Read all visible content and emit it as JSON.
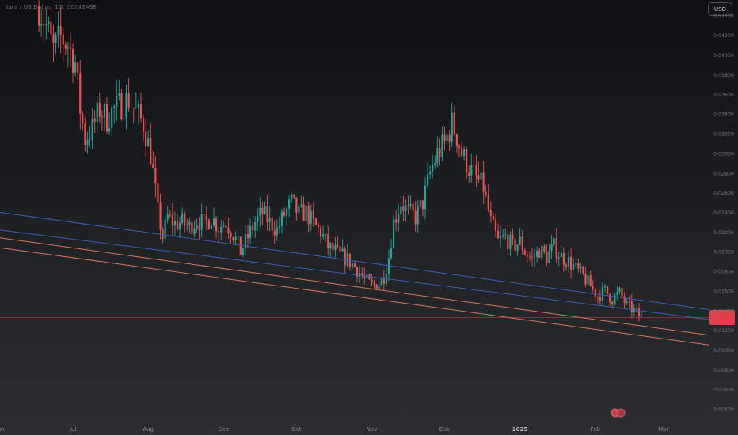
{
  "header": {
    "symbol_label": "Vara / US Dollar, 1D, COINBASE",
    "currency_button": "USD"
  },
  "colors": {
    "up": "#26a69a",
    "down": "#ef5350",
    "channel_blue": "#3d5fb8",
    "channel_orange": "#d8795e",
    "last_price": "#e0404b"
  },
  "chart_data": {
    "type": "candlestick",
    "x_axis": {
      "tick_labels": [
        "Jun",
        "Jul",
        "Aug",
        "Sep",
        "Oct",
        "Nov",
        "Dec",
        "2025",
        "Feb",
        "Mar"
      ],
      "tick_dates": [
        "2024-06-01",
        "2024-07-01",
        "2024-08-01",
        "2024-09-01",
        "2024-10-01",
        "2024-11-01",
        "2024-12-01",
        "2025-01-01",
        "2025-02-01",
        "2025-03-01"
      ],
      "range": [
        "2024-06-01",
        "2025-03-20"
      ]
    },
    "y_axis": {
      "tick_labels": [
        "0.04400",
        "0.04200",
        "0.04000",
        "0.03800",
        "0.03600",
        "0.03400",
        "0.03200",
        "0.03000",
        "0.02800",
        "0.02600",
        "0.02400",
        "0.02200",
        "0.02000",
        "0.01800",
        "0.01600",
        "0.01400",
        "0.01200",
        "0.01000",
        "0.00800",
        "0.00600",
        "0.00400"
      ],
      "tick_values": [
        0.044,
        0.042,
        0.04,
        0.038,
        0.036,
        0.034,
        0.032,
        0.03,
        0.028,
        0.026,
        0.024,
        0.022,
        0.02,
        0.018,
        0.016,
        0.014,
        0.012,
        0.01,
        0.008,
        0.006,
        0.004
      ],
      "range": [
        0.0028,
        0.0456
      ]
    },
    "close_path": [
      [
        "2024-06-17",
        0.045
      ],
      [
        "2024-06-20",
        0.043
      ],
      [
        "2024-06-23",
        0.0405
      ],
      [
        "2024-06-26",
        0.0418
      ],
      [
        "2024-06-29",
        0.041
      ],
      [
        "2024-07-02",
        0.0392
      ],
      [
        "2024-07-04",
        0.0345
      ],
      [
        "2024-07-06",
        0.0315
      ],
      [
        "2024-07-09",
        0.0325
      ],
      [
        "2024-07-12",
        0.0345
      ],
      [
        "2024-07-15",
        0.0335
      ],
      [
        "2024-07-18",
        0.0345
      ],
      [
        "2024-07-21",
        0.035
      ],
      [
        "2024-07-24",
        0.0355
      ],
      [
        "2024-07-27",
        0.0342
      ],
      [
        "2024-07-30",
        0.033
      ],
      [
        "2024-08-02",
        0.03
      ],
      [
        "2024-08-05",
        0.024
      ],
      [
        "2024-08-07",
        0.0215
      ],
      [
        "2024-08-09",
        0.0235
      ],
      [
        "2024-08-12",
        0.0228
      ],
      [
        "2024-08-15",
        0.023
      ],
      [
        "2024-08-18",
        0.0225
      ],
      [
        "2024-08-21",
        0.0232
      ],
      [
        "2024-08-24",
        0.0228
      ],
      [
        "2024-08-27",
        0.0235
      ],
      [
        "2024-08-30",
        0.0225
      ],
      [
        "2024-09-02",
        0.023
      ],
      [
        "2024-09-05",
        0.0218
      ],
      [
        "2024-09-08",
        0.02
      ],
      [
        "2024-09-11",
        0.0215
      ],
      [
        "2024-09-14",
        0.023
      ],
      [
        "2024-09-17",
        0.024
      ],
      [
        "2024-09-20",
        0.023
      ],
      [
        "2024-09-23",
        0.0222
      ],
      [
        "2024-09-26",
        0.0238
      ],
      [
        "2024-09-29",
        0.025
      ],
      [
        "2024-10-02",
        0.0238
      ],
      [
        "2024-10-05",
        0.024
      ],
      [
        "2024-10-08",
        0.0228
      ],
      [
        "2024-10-11",
        0.022
      ],
      [
        "2024-10-14",
        0.0205
      ],
      [
        "2024-10-17",
        0.02
      ],
      [
        "2024-10-20",
        0.0195
      ],
      [
        "2024-10-23",
        0.019
      ],
      [
        "2024-10-26",
        0.0182
      ],
      [
        "2024-10-29",
        0.0172
      ],
      [
        "2024-11-01",
        0.0165
      ],
      [
        "2024-11-04",
        0.0168
      ],
      [
        "2024-11-06",
        0.0175
      ],
      [
        "2024-11-08",
        0.0195
      ],
      [
        "2024-11-10",
        0.023
      ],
      [
        "2024-11-13",
        0.025
      ],
      [
        "2024-11-16",
        0.024
      ],
      [
        "2024-11-19",
        0.0235
      ],
      [
        "2024-11-22",
        0.025
      ],
      [
        "2024-11-25",
        0.028
      ],
      [
        "2024-11-28",
        0.03
      ],
      [
        "2024-12-01",
        0.031
      ],
      [
        "2024-12-04",
        0.033
      ],
      [
        "2024-12-06",
        0.0318
      ],
      [
        "2024-12-08",
        0.03
      ],
      [
        "2024-12-11",
        0.0285
      ],
      [
        "2024-12-14",
        0.0275
      ],
      [
        "2024-12-17",
        0.0265
      ],
      [
        "2024-12-20",
        0.023
      ],
      [
        "2024-12-23",
        0.021
      ],
      [
        "2024-12-26",
        0.0215
      ],
      [
        "2024-12-29",
        0.0205
      ],
      [
        "2025-01-01",
        0.021
      ],
      [
        "2025-01-03",
        0.02
      ],
      [
        "2025-01-06",
        0.0192
      ],
      [
        "2025-01-09",
        0.0202
      ],
      [
        "2025-01-12",
        0.0195
      ],
      [
        "2025-01-15",
        0.0205
      ],
      [
        "2025-01-18",
        0.0195
      ],
      [
        "2025-01-21",
        0.019
      ],
      [
        "2025-01-24",
        0.0182
      ],
      [
        "2025-01-27",
        0.0175
      ],
      [
        "2025-01-30",
        0.0165
      ],
      [
        "2025-02-02",
        0.0155
      ],
      [
        "2025-02-05",
        0.016
      ],
      [
        "2025-02-08",
        0.0152
      ],
      [
        "2025-02-11",
        0.0158
      ],
      [
        "2025-02-14",
        0.0145
      ],
      [
        "2025-02-17",
        0.014
      ],
      [
        "2025-02-20",
        0.0132
      ]
    ],
    "annotations": {
      "last_price": 0.0133,
      "channel_lines": [
        {
          "color": "blue",
          "from": [
            "2024-06-01",
            0.024
          ],
          "to": [
            "2025-03-20",
            0.0141
          ]
        },
        {
          "color": "blue",
          "from": [
            "2024-06-01",
            0.0222
          ],
          "to": [
            "2025-03-20",
            0.0131
          ]
        },
        {
          "color": "orange",
          "from": [
            "2024-06-01",
            0.0214
          ],
          "to": [
            "2025-03-20",
            0.0115
          ]
        },
        {
          "color": "orange",
          "from": [
            "2024-06-01",
            0.0204
          ],
          "to": [
            "2025-03-20",
            0.0105
          ]
        }
      ]
    }
  }
}
